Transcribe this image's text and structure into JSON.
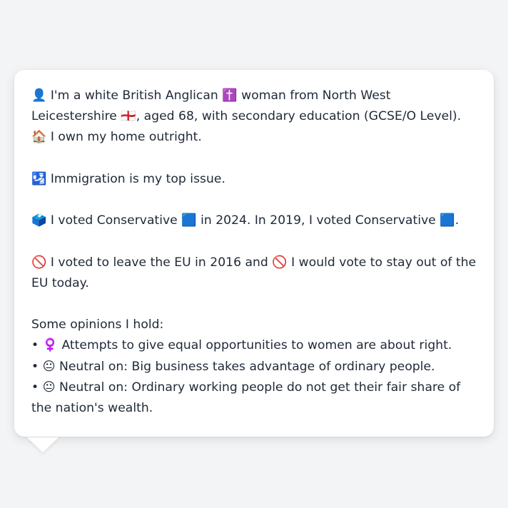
{
  "persona": {
    "intro": "👤 I'm a white British Anglican ✝️ woman from North West Leicestershire 🏴󠁧󠁢󠁥󠁮󠁧󠁿, aged 68, with secondary education (GCSE/O Level). 🏠 I own my home outright.",
    "top_issue": "🛂 Immigration is my top issue.",
    "vote": "🗳️ I voted Conservative 🟦 in 2024. In 2019, I voted Conservative 🟦.",
    "eu": "🚫 I voted to leave the EU in 2016 and 🚫 I would vote to stay out of the EU today.",
    "opinions_heading": "Some opinions I hold:",
    "opinions": [
      "• ♀️ Attempts to give equal opportunities to women are about right.",
      "• 😐 Neutral on: Big business takes advantage of ordinary people.",
      "• 😐 Neutral on: Ordinary working people do not get their fair share of the nation's wealth."
    ]
  }
}
